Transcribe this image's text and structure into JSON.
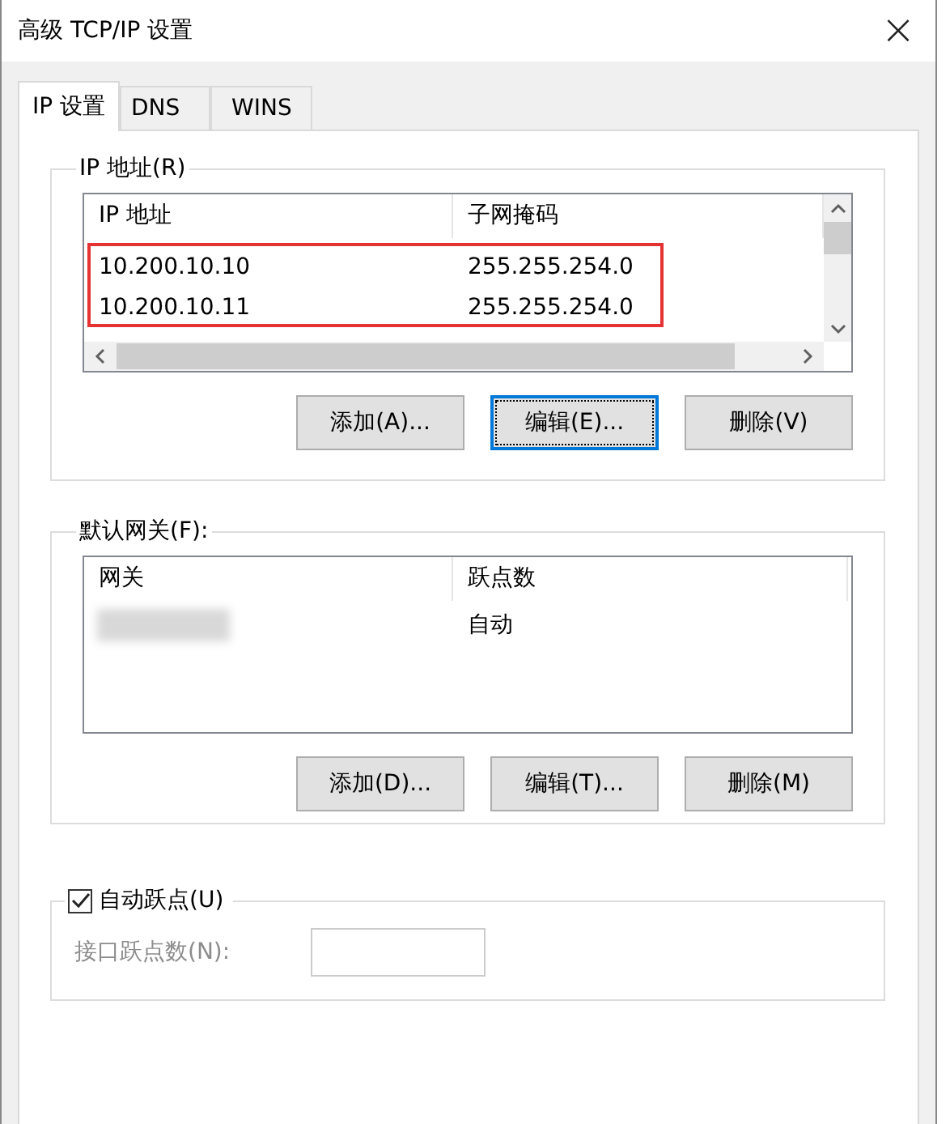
{
  "window": {
    "title": "高级 TCP/IP 设置",
    "close": "×"
  },
  "tabs": [
    {
      "label": "IP 设置",
      "selected": true
    },
    {
      "label": "DNS",
      "selected": false
    },
    {
      "label": "WINS",
      "selected": false
    }
  ],
  "ip_group": {
    "title": "IP 地址(R)",
    "highlight_box": true,
    "columns": [
      "IP 地址",
      "子网掩码"
    ],
    "rows": [
      {
        "cells": [
          "10.200.10.10",
          "255.255.254.0"
        ]
      },
      {
        "cells": [
          "10.200.10.11",
          "255.255.254.0"
        ]
      }
    ],
    "buttons": [
      {
        "label": "添加(A)...",
        "selected": false
      },
      {
        "label": "编辑(E)...",
        "selected": true
      },
      {
        "label": "删除(V)",
        "selected": false
      }
    ]
  },
  "gateway_group": {
    "title": "默认网关(F):",
    "columns": [
      "网关",
      "跃点数"
    ],
    "rows": [
      {
        "cells": [
          null,
          "自动"
        ],
        "redacted": true
      }
    ],
    "buttons": [
      {
        "label": "添加(D)...",
        "selected": false
      },
      {
        "label": "编辑(T)...",
        "selected": false
      },
      {
        "label": "删除(M)",
        "selected": false
      }
    ]
  },
  "metric": {
    "label": "自动跃点(U)",
    "checked": true,
    "field_label": "接口跃点数(N):",
    "disabled": true
  }
}
